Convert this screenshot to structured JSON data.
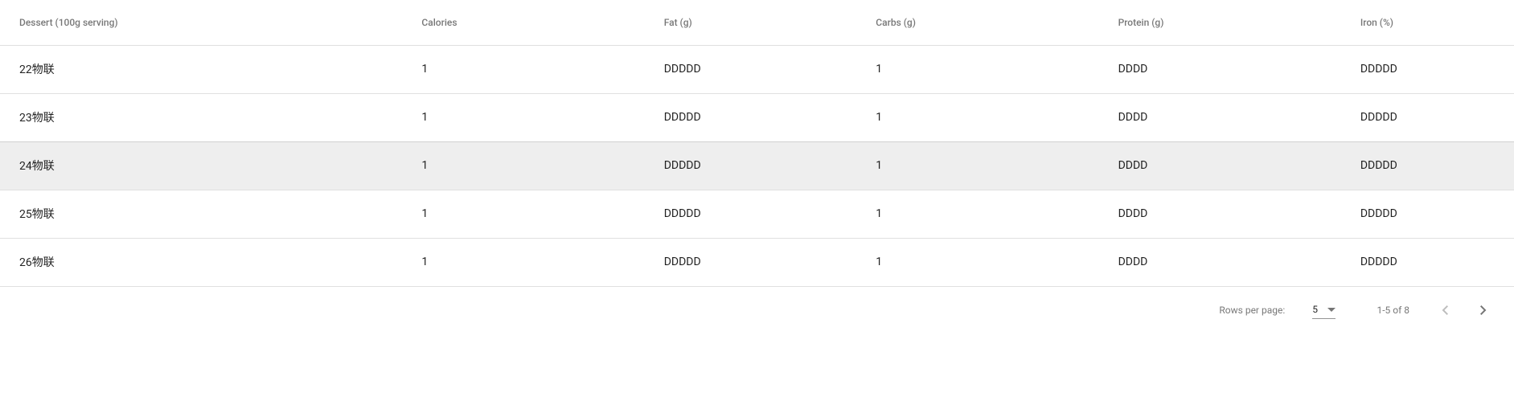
{
  "table": {
    "columns": [
      {
        "label": "Dessert (100g serving)"
      },
      {
        "label": "Calories"
      },
      {
        "label": "Fat (g)"
      },
      {
        "label": "Carbs (g)"
      },
      {
        "label": "Protein (g)"
      },
      {
        "label": "Iron (%)"
      }
    ],
    "rows": [
      {
        "dessert": "22物联",
        "calories": "1",
        "fat": "DDDDD",
        "carbs": "1",
        "protein": "DDDD",
        "iron": "DDDDD"
      },
      {
        "dessert": "23物联",
        "calories": "1",
        "fat": "DDDDD",
        "carbs": "1",
        "protein": "DDDD",
        "iron": "DDDDD"
      },
      {
        "dessert": "24物联",
        "calories": "1",
        "fat": "DDDDD",
        "carbs": "1",
        "protein": "DDDD",
        "iron": "DDDDD"
      },
      {
        "dessert": "25物联",
        "calories": "1",
        "fat": "DDDDD",
        "carbs": "1",
        "protein": "DDDD",
        "iron": "DDDDD"
      },
      {
        "dessert": "26物联",
        "calories": "1",
        "fat": "DDDDD",
        "carbs": "1",
        "protein": "DDDD",
        "iron": "DDDDD"
      }
    ],
    "hovered_row_index": 2
  },
  "footer": {
    "rows_per_page_label": "Rows per page:",
    "rows_per_page_value": "5",
    "page_range": "1-5 of 8",
    "prev_disabled": true,
    "next_disabled": false
  }
}
